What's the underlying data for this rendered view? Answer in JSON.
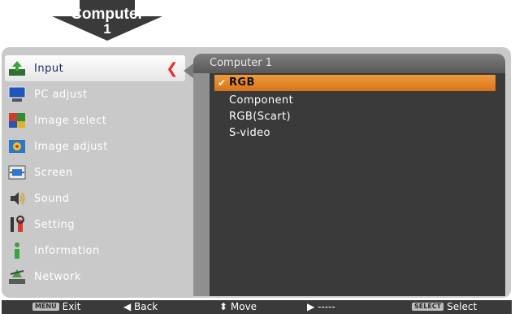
{
  "source_badge": {
    "line1": "Computer",
    "line2": "1"
  },
  "menu": {
    "items": [
      {
        "label": "Input",
        "icon": "input-icon"
      },
      {
        "label": "PC adjust",
        "icon": "pc-adjust-icon"
      },
      {
        "label": "Image select",
        "icon": "image-select-icon"
      },
      {
        "label": "Image adjust",
        "icon": "image-adjust-icon"
      },
      {
        "label": "Screen",
        "icon": "screen-icon"
      },
      {
        "label": "Sound",
        "icon": "sound-icon"
      },
      {
        "label": "Setting",
        "icon": "setting-icon"
      },
      {
        "label": "Information",
        "icon": "information-icon"
      },
      {
        "label": "Network",
        "icon": "network-icon"
      }
    ],
    "active_index": 0
  },
  "submenu": {
    "title": "Computer 1",
    "options": [
      "RGB",
      "Component",
      "RGB(Scart)",
      "S-video"
    ],
    "selected_index": 0
  },
  "bottombar": {
    "exit_key": "MENU",
    "exit_label": "Exit",
    "back_label": "Back",
    "move_label": "Move",
    "next_label": "-----",
    "select_key": "SELECT",
    "select_label": "Select"
  },
  "colors": {
    "frame": "#c9c9c9",
    "panel_body": "#3a3a3a",
    "selection": "#e0812a",
    "accent_red": "#e8312f"
  }
}
